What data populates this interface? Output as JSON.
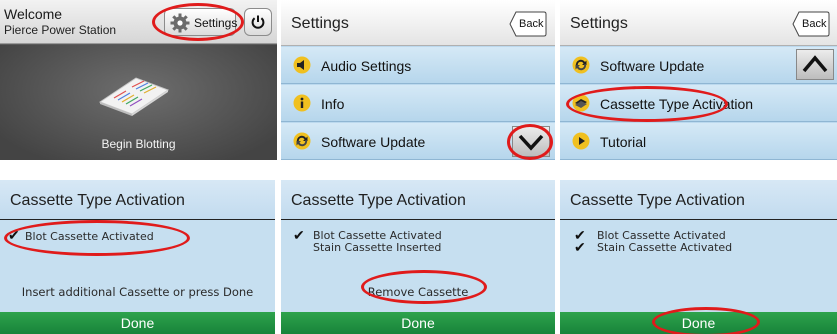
{
  "home": {
    "welcome": "Welcome",
    "station": "Pierce Power Station",
    "settings_label": "Settings",
    "begin_label": "Begin Blotting"
  },
  "settings_page1": {
    "title": "Settings",
    "back_label": "Back",
    "items": [
      {
        "label": "Audio Settings",
        "icon": "speaker-icon"
      },
      {
        "label": "Info",
        "icon": "info-icon"
      },
      {
        "label": "Software Update",
        "icon": "software-update-icon"
      }
    ]
  },
  "settings_page2": {
    "title": "Settings",
    "back_label": "Back",
    "items": [
      {
        "label": "Software Update",
        "icon": "software-update-icon"
      },
      {
        "label": "Cassette Type Activation",
        "icon": "cassette-icon"
      },
      {
        "label": "Tutorial",
        "icon": "play-icon"
      }
    ]
  },
  "activation_step1": {
    "title": "Cassette Type Activation",
    "lines": [
      "Blot Cassette Activated"
    ],
    "message": "Insert additional Cassette or press Done",
    "done_label": "Done"
  },
  "activation_step2": {
    "title": "Cassette Type Activation",
    "lines": [
      "Blot Cassette Activated",
      "Stain Cassette Inserted"
    ],
    "remove_label": "Remove Cassette",
    "done_label": "Done"
  },
  "activation_step3": {
    "title": "Cassette Type Activation",
    "lines": [
      "Blot Cassette Activated",
      "Stain Cassette Activated"
    ],
    "done_label": "Done"
  },
  "colors": {
    "highlight": "#e01b1b",
    "done_green": "#1e8f40",
    "menu_blue": "#bcd9ee"
  }
}
